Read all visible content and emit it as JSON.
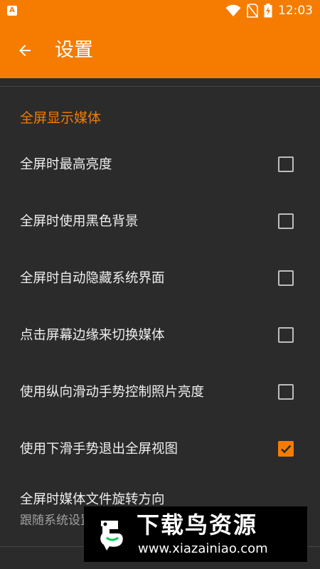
{
  "status_bar": {
    "time": "12:03",
    "icons": [
      "app-notification-icon",
      "wifi-icon",
      "no-sim-icon",
      "battery-charging-icon"
    ]
  },
  "app_bar": {
    "title": "设置",
    "back_icon": "arrow-left-icon"
  },
  "section": {
    "header": "全屏显示媒体"
  },
  "settings": [
    {
      "label": "全屏时最高亮度",
      "checked": false
    },
    {
      "label": "全屏时使用黑色背景",
      "checked": false
    },
    {
      "label": "全屏时自动隐藏系统界面",
      "checked": false
    },
    {
      "label": "点击屏幕边缘来切换媒体",
      "checked": false
    },
    {
      "label": "使用纵向滑动手势控制照片亮度",
      "checked": false
    },
    {
      "label": "使用下滑手势退出全屏视图",
      "checked": true
    }
  ],
  "rotation_setting": {
    "title": "全屏时媒体文件旋转方向",
    "summary": "跟随系统设置"
  },
  "watermark": {
    "title": "下载鸟资源",
    "url": "www.xiazainiao.com"
  },
  "colors": {
    "accent": "#f57c00",
    "background": "#2b2b2b",
    "text": "#eeeeee"
  }
}
